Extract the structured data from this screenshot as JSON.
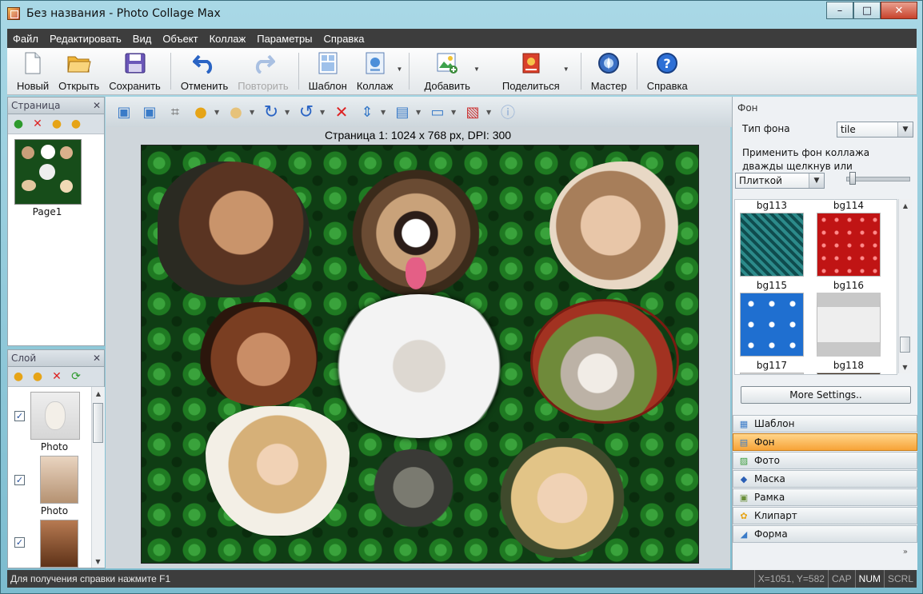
{
  "window": {
    "title": "Без названия - Photo Collage Max",
    "controls": [
      "–",
      "□",
      "✕"
    ]
  },
  "menu": [
    "Файл",
    "Редактировать",
    "Вид",
    "Объект",
    "Коллаж",
    "Параметры",
    "Справка"
  ],
  "toolbar": {
    "new": "Новый",
    "open": "Открыть",
    "save": "Сохранить",
    "undo": "Отменить",
    "redo": "Повторить",
    "template": "Шаблон",
    "collage": "Коллаж",
    "add": "Добавить",
    "share": "Поделиться",
    "wizard": "Мастер",
    "help": "Справка"
  },
  "pages_panel": {
    "title": "Страница",
    "items": [
      {
        "label": "Page1"
      }
    ]
  },
  "layers_panel": {
    "title": "Слой",
    "items": [
      {
        "label": "Photo",
        "checked": true
      },
      {
        "label": "Photo",
        "checked": true
      },
      {
        "label": "",
        "checked": true
      }
    ]
  },
  "canvas": {
    "caption": "Страница 1: 1024 x 768 px, DPI: 300"
  },
  "background_panel": {
    "title": "Фон",
    "type_label": "Тип фона",
    "type_value": "tile",
    "apply_text_line1": "Применить фон коллажа",
    "apply_text_line2": "дважды щелкнув или",
    "mode_value": "Плиткой",
    "items": [
      {
        "label": "bg113",
        "color": "#1f6b73"
      },
      {
        "label": "bg114",
        "color": "#c01414"
      },
      {
        "label": "bg115",
        "color": "#1f6fd0"
      },
      {
        "label": "bg116",
        "color": "#eeeeee"
      },
      {
        "label": "bg117",
        "color": "#cccccc"
      },
      {
        "label": "bg118",
        "color": "#3a2a1a"
      }
    ],
    "more_settings": "More Settings.."
  },
  "nav": [
    {
      "label": "Шаблон",
      "icon": "template-icon",
      "active": false
    },
    {
      "label": "Фон",
      "icon": "background-icon",
      "active": true
    },
    {
      "label": "Фото",
      "icon": "photo-icon",
      "active": false
    },
    {
      "label": "Маска",
      "icon": "mask-icon",
      "active": false
    },
    {
      "label": "Рамка",
      "icon": "frame-icon",
      "active": false
    },
    {
      "label": "Клипарт",
      "icon": "clipart-icon",
      "active": false
    },
    {
      "label": "Форма",
      "icon": "shape-icon",
      "active": false
    }
  ],
  "status": {
    "help": "Для получения справки нажмите F1",
    "coords": "X=1051, Y=582",
    "cap": "CAP",
    "num": "NUM",
    "scrl": "SCRL"
  }
}
